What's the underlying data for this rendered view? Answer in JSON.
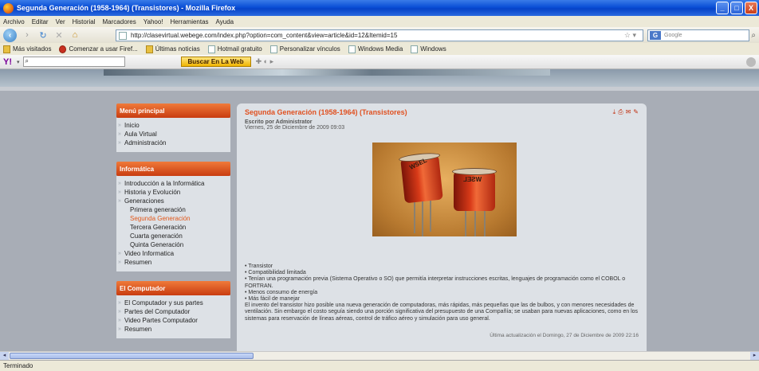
{
  "window": {
    "title": "Segunda Generación (1958-1964) (Transistores) - Mozilla Firefox",
    "buttons": [
      "_",
      "□",
      "X"
    ]
  },
  "menubar": [
    "Archivo",
    "Editar",
    "Ver",
    "Historial",
    "Marcadores",
    "Yahoo!",
    "Herramientas",
    "Ayuda"
  ],
  "navbar": {
    "url": "http://clasevirtual.webege.com/index.php?option=com_content&view=article&id=12&Itemid=15",
    "search_placeholder": "Google",
    "icons": [
      "back-icon",
      "forward-icon",
      "reload-icon",
      "stop-icon",
      "home-icon"
    ]
  },
  "bookmarks": [
    "Más visitados",
    "Comenzar a usar Firef...",
    "Últimas noticias",
    "Hotmail gratuito",
    "Personalizar vínculos",
    "Windows Media",
    "Windows"
  ],
  "yahoo": {
    "logo": "Y!",
    "button": "Buscar En La Web"
  },
  "sidebar": {
    "menu_principal": {
      "title": "Menú principal",
      "items": [
        "Inicio",
        "Aula Virtual",
        "Administración"
      ]
    },
    "informatica": {
      "title": "Informática",
      "items": [
        {
          "label": "Introducción a la Informática",
          "sub": false,
          "active": false
        },
        {
          "label": "Historia y Evolución",
          "sub": false,
          "active": false
        },
        {
          "label": "Generaciones",
          "sub": false,
          "active": false
        },
        {
          "label": "Primera generación",
          "sub": true,
          "active": false
        },
        {
          "label": "Segunda Generación",
          "sub": true,
          "active": true
        },
        {
          "label": "Tercera Generación",
          "sub": true,
          "active": false
        },
        {
          "label": "Cuarta generación",
          "sub": true,
          "active": false
        },
        {
          "label": "Quinta Generación",
          "sub": true,
          "active": false
        },
        {
          "label": "Video Informatica",
          "sub": false,
          "active": false
        },
        {
          "label": "Resumen",
          "sub": false,
          "active": false
        }
      ]
    },
    "computador": {
      "title": "El Computador",
      "items": [
        "El Computador y sus partes",
        "Partes del Computador",
        "Video Partes Computador",
        "Resumen"
      ]
    }
  },
  "article": {
    "title": "Segunda Generación (1958-1964) (Transistores)",
    "author": "Escrito por Administrator",
    "date": "Viernes, 25 de Diciembre de 2009 09:03",
    "photo_text": [
      "WSEL",
      "WSEL"
    ],
    "lines": [
      "• Transistor",
      "• Compatibilidad limitada",
      "• Tenían una programación previa  (Sistema Operativo o SO) que permitía interpretar instrucciones escritas, lenguajes de programación como el COBOL o FORTRAN.",
      "• Menos consumo de energía",
      "• Más fácil de manejar",
      "El invento del transistor hizo posible  una nueva generación de computadoras, más rápidas, más pequeñas que las de bulbos, y con menores necesidades de ventilación. Sin embargo el costo seguía siendo  una porción significativa del presupuesto de una Compañía;  se usaban para nuevas aplicaciones, como en los sistemas para reservación de líneas aéreas, control de tráfico aéreo y simulación para uso general."
    ],
    "footer": "Última actualización el Domingo, 27 de Diciembre de 2009 22:16"
  },
  "status": "Terminado"
}
